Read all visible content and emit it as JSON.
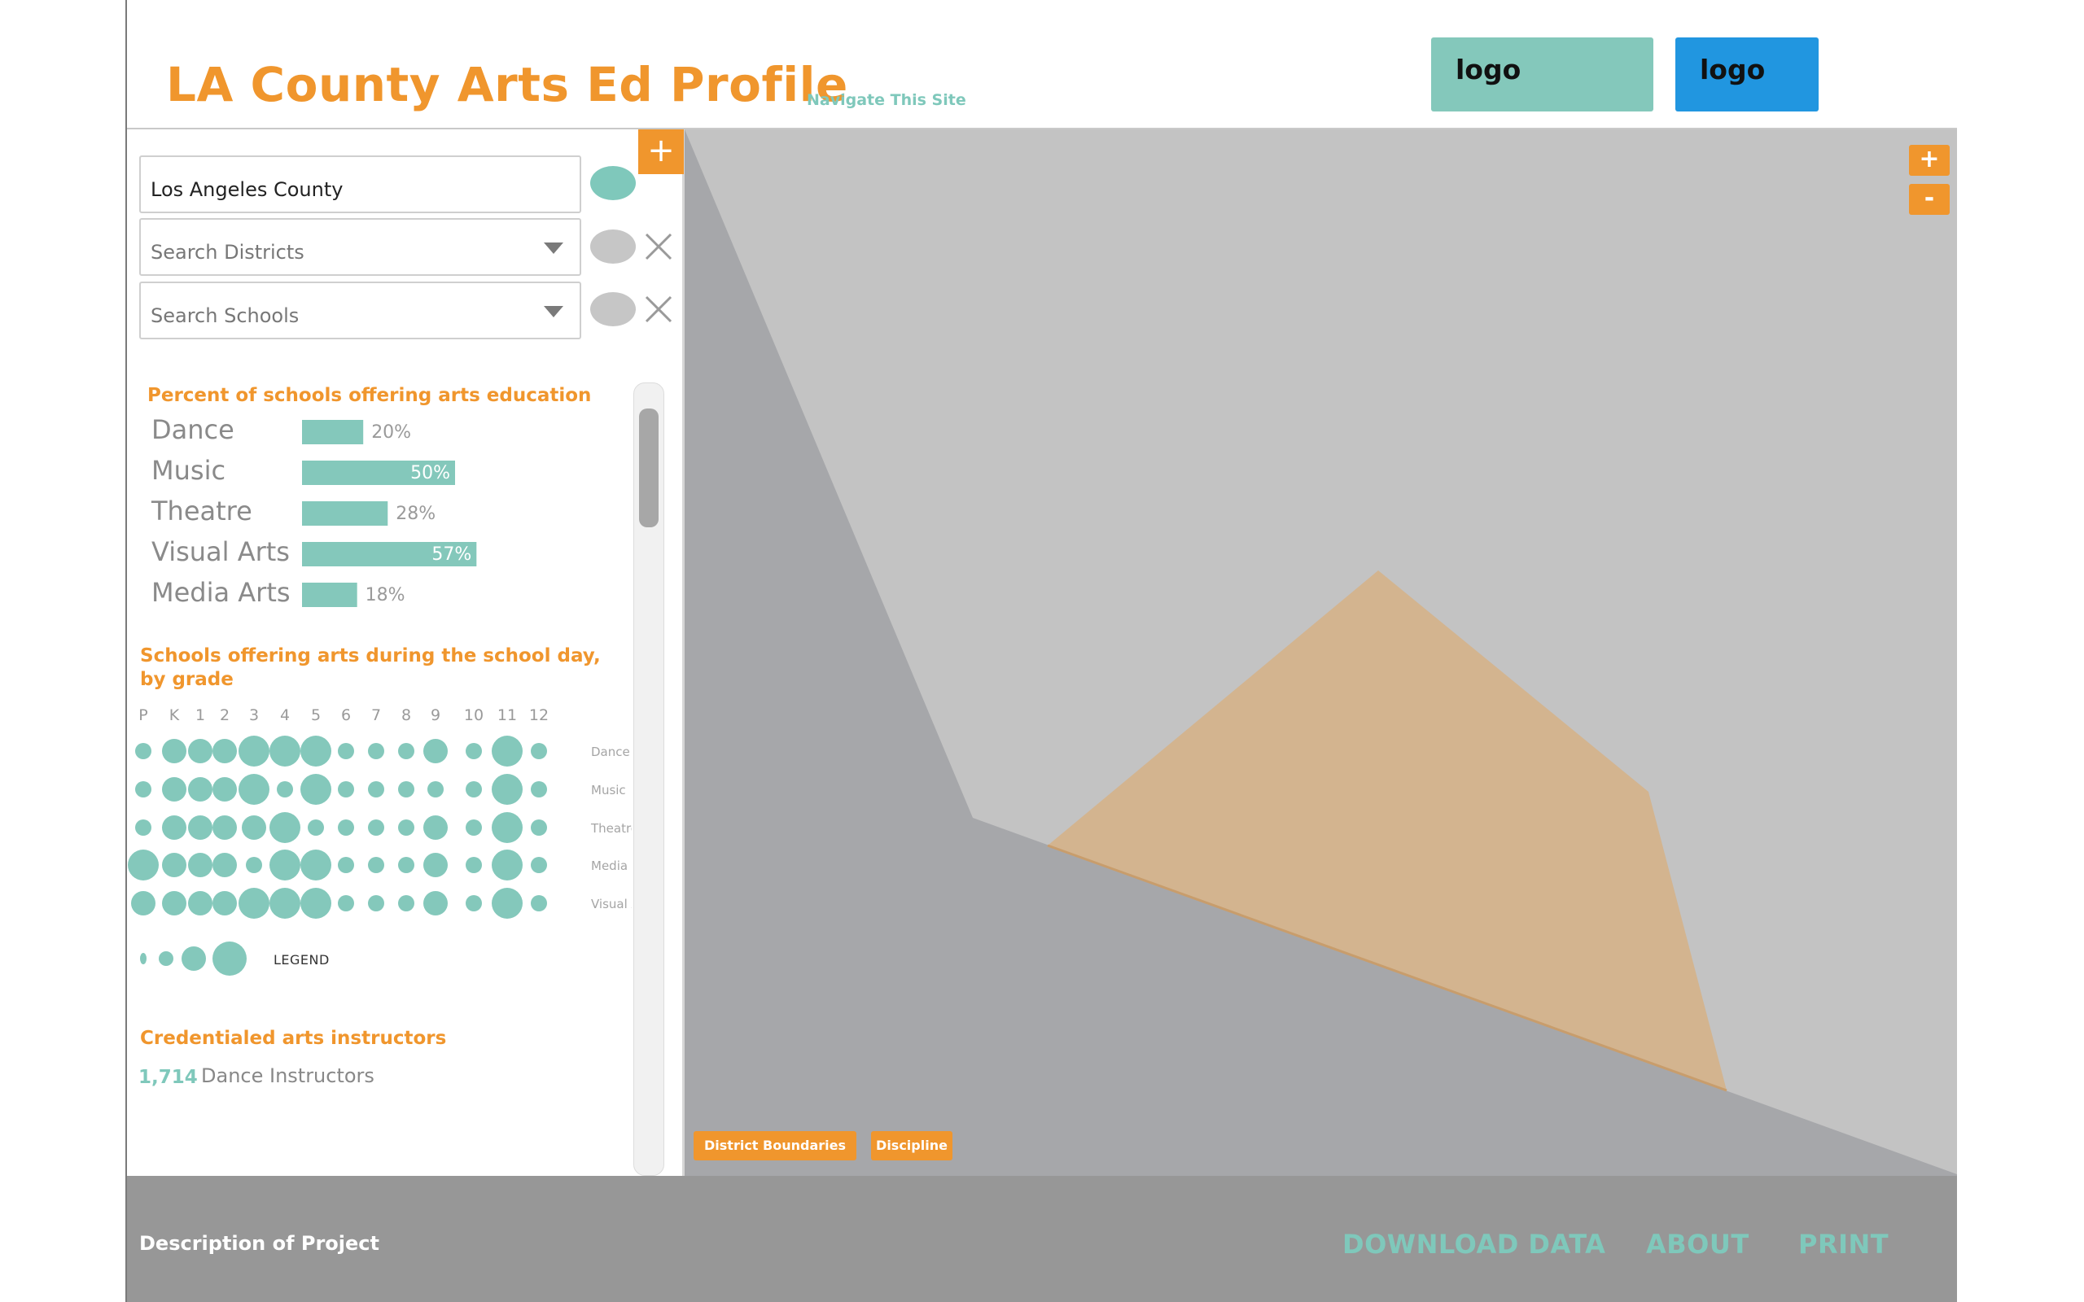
{
  "header": {
    "title": "LA County Arts Ed Profile",
    "nav_link": "Navigate This Site",
    "logo_1": "logo",
    "logo_2": "logo",
    "colors": {
      "accent": "#f0962d",
      "teal": "#7fc8bb",
      "blue": "#2196e0"
    }
  },
  "panel": {
    "add_button": "+",
    "county_field": "Los Angeles County",
    "districts_placeholder": "Search Districts",
    "schools_placeholder": "Search Schools",
    "toggles": [
      "on",
      "off",
      "off"
    ],
    "percent_title": "Percent of schools offering arts education",
    "grade_title_line1": "Schools offering arts during the school day,",
    "grade_title_line2": "by grade",
    "legend_label": "LEGEND",
    "instructors_title": "Credentialed arts instructors",
    "instructors_count": "1,714",
    "instructors_label": "Dance Instructors"
  },
  "chart_data": [
    {
      "type": "bar",
      "title": "Percent of schools offering arts education",
      "categories": [
        "Dance",
        "Music",
        "Theatre",
        "Visual Arts",
        "Media Arts"
      ],
      "values": [
        20,
        50,
        28,
        57,
        18
      ],
      "labels": [
        "20%",
        "50%",
        "28%",
        "57%",
        "18%"
      ],
      "ylim": [
        0,
        100
      ],
      "color": "#84c8bb"
    },
    {
      "type": "scatter",
      "title": "Schools offering arts during the school day, by grade",
      "x": [
        "P",
        "K",
        "1",
        "2",
        "3",
        "4",
        "5",
        "6",
        "7",
        "8",
        "9",
        "10",
        "11",
        "12"
      ],
      "rows": [
        "Dance",
        "Music",
        "Theatre",
        "Media Arts",
        "Visual Arts"
      ],
      "size_levels": [
        1,
        2,
        3,
        4
      ],
      "sizes": [
        [
          1,
          2,
          2,
          2,
          3,
          3,
          3,
          1,
          1,
          1,
          2,
          1,
          3,
          1
        ],
        [
          1,
          2,
          2,
          2,
          3,
          1,
          3,
          1,
          1,
          1,
          1,
          1,
          3,
          1
        ],
        [
          1,
          2,
          2,
          2,
          2,
          3,
          1,
          1,
          1,
          1,
          2,
          1,
          3,
          1
        ],
        [
          3,
          2,
          2,
          2,
          1,
          3,
          3,
          1,
          1,
          1,
          2,
          1,
          3,
          1
        ],
        [
          2,
          2,
          2,
          2,
          3,
          3,
          3,
          1,
          1,
          1,
          2,
          1,
          3,
          1
        ]
      ],
      "color": "#84c8bb"
    }
  ],
  "map": {
    "zoom_in": "+",
    "zoom_out": "-",
    "chip_district": "District Boundaries",
    "chip_discipline": "Discipline",
    "background_color": "#c3c3c3",
    "region_color": "#a6a7aa",
    "highlight_color": "#d3b48f"
  },
  "footer": {
    "description": "Description of Project",
    "download": "DOWNLOAD DATA",
    "about": "ABOUT",
    "print": "PRINT"
  }
}
